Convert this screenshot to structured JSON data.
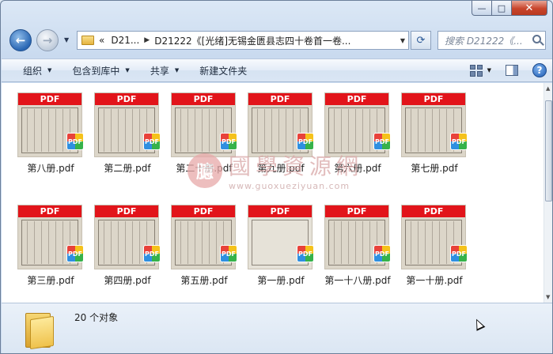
{
  "window": {
    "minimize_glyph": "—",
    "maximize_glyph": "□",
    "close_glyph": "✕"
  },
  "nav": {
    "back_icon": "back-arrow-icon",
    "forward_icon": "forward-arrow-icon"
  },
  "address": {
    "overflow": "«",
    "crumbs": [
      "D21...",
      "D21222《[光绪]无锡金匮县志四十卷首一卷..."
    ]
  },
  "search": {
    "placeholder": "搜索 D21222《..."
  },
  "toolbar": {
    "organize": "组织",
    "include_in_library": "包含到库中",
    "share": "共享",
    "new_folder": "新建文件夹",
    "help": "?"
  },
  "files": [
    {
      "name": "第八册.pdf",
      "banner": "PDF",
      "badge": "PDF"
    },
    {
      "name": "第二册.pdf",
      "banner": "PDF",
      "badge": "PDF"
    },
    {
      "name": "第二十册.pdf",
      "banner": "PDF",
      "badge": "PDF"
    },
    {
      "name": "第九册.pdf",
      "banner": "PDF",
      "badge": "PDF"
    },
    {
      "name": "第六册.pdf",
      "banner": "PDF",
      "badge": "PDF"
    },
    {
      "name": "第七册.pdf",
      "banner": "PDF",
      "badge": "PDF"
    },
    {
      "name": "第三册.pdf",
      "banner": "PDF",
      "badge": "PDF"
    },
    {
      "name": "第四册.pdf",
      "banner": "PDF",
      "badge": "PDF"
    },
    {
      "name": "第五册.pdf",
      "banner": "PDF",
      "badge": "PDF"
    },
    {
      "name": "第一册.pdf",
      "banner": "PDF",
      "badge": "PDF"
    },
    {
      "name": "第一十八册.pdf",
      "banner": "PDF",
      "badge": "PDF"
    },
    {
      "name": "第一十册.pdf",
      "banner": "PDF",
      "badge": "PDF"
    }
  ],
  "watermark": {
    "seal": "臆",
    "text": "國學資源網",
    "url": "www.guoxueziyuan.com"
  },
  "status": {
    "count": "20 个对象"
  },
  "colors": {
    "pdf_banner": "#e2141a",
    "toolbar_bg": "#dae6f4",
    "close_button": "#c8452c"
  }
}
